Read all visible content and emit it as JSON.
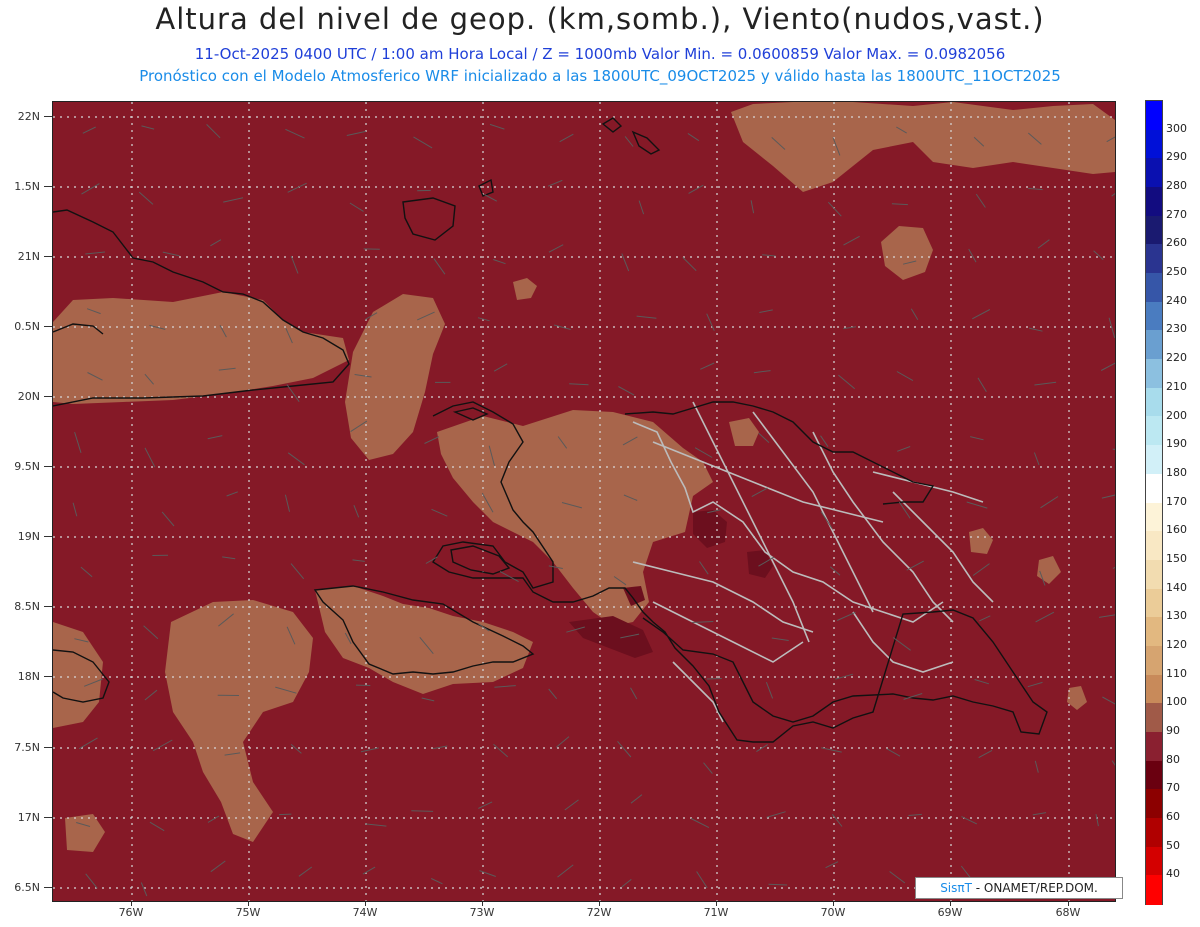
{
  "header": {
    "title": "Altura del nivel de geop. (km,somb.), Viento(nudos,vast.)",
    "subtitle1": "11-Oct-2025  0400 UTC / 1:00 am Hora Local / Z = 1000mb Valor Min. = 0.0600859  Valor Max. = 0.0982056",
    "subtitle2": "Pronóstico con el Modelo Atmosferico WRF inicializado a las 1800UTC_09OCT2025 y válido hasta las  1800UTC_11OCT2025"
  },
  "axes": {
    "lat_labels": [
      "22N",
      "1.5N",
      "21N",
      "0.5N",
      "20N",
      "9.5N",
      "19N",
      "8.5N",
      "18N",
      "7.5N",
      "17N",
      "6.5N"
    ],
    "lon_labels": [
      "76W",
      "75W",
      "74W",
      "73W",
      "72W",
      "71W",
      "70W",
      "69W",
      "68W"
    ]
  },
  "colorbar": {
    "labels": [
      "300",
      "290",
      "280",
      "270",
      "260",
      "250",
      "240",
      "230",
      "220",
      "210",
      "200",
      "190",
      "180",
      "170",
      "160",
      "150",
      "140",
      "130",
      "120",
      "110",
      "100",
      "90",
      "80",
      "70",
      "60",
      "50",
      "40"
    ],
    "colors": [
      "#0000ff",
      "#0010d8",
      "#0a10b0",
      "#120c80",
      "#1a1a70",
      "#2a3490",
      "#3656a8",
      "#4a7cc0",
      "#6a9fd0",
      "#8cc0e0",
      "#a8dcec",
      "#bce8f2",
      "#d2f0f8",
      "#ffffff",
      "#fdf3d8",
      "#f9e8c4",
      "#f2dcb0",
      "#ebcc98",
      "#e2b880",
      "#d6a470",
      "#c88a5a",
      "#a05a48",
      "#8a2030",
      "#6a0010",
      "#8c0000",
      "#b00000",
      "#d40000",
      "#ff0000"
    ]
  },
  "map": {
    "colors": {
      "background": "#851927",
      "field_high": "#a8654b",
      "field_max": "#6c0f1e",
      "coastline": "#111111",
      "provinces": "#bcbcbc",
      "grid": "#d8d8d8",
      "barbs": "#5a5a5a"
    }
  },
  "credit": {
    "brand": "SisπT",
    "text": " - ONAMET/REP.DOM."
  }
}
